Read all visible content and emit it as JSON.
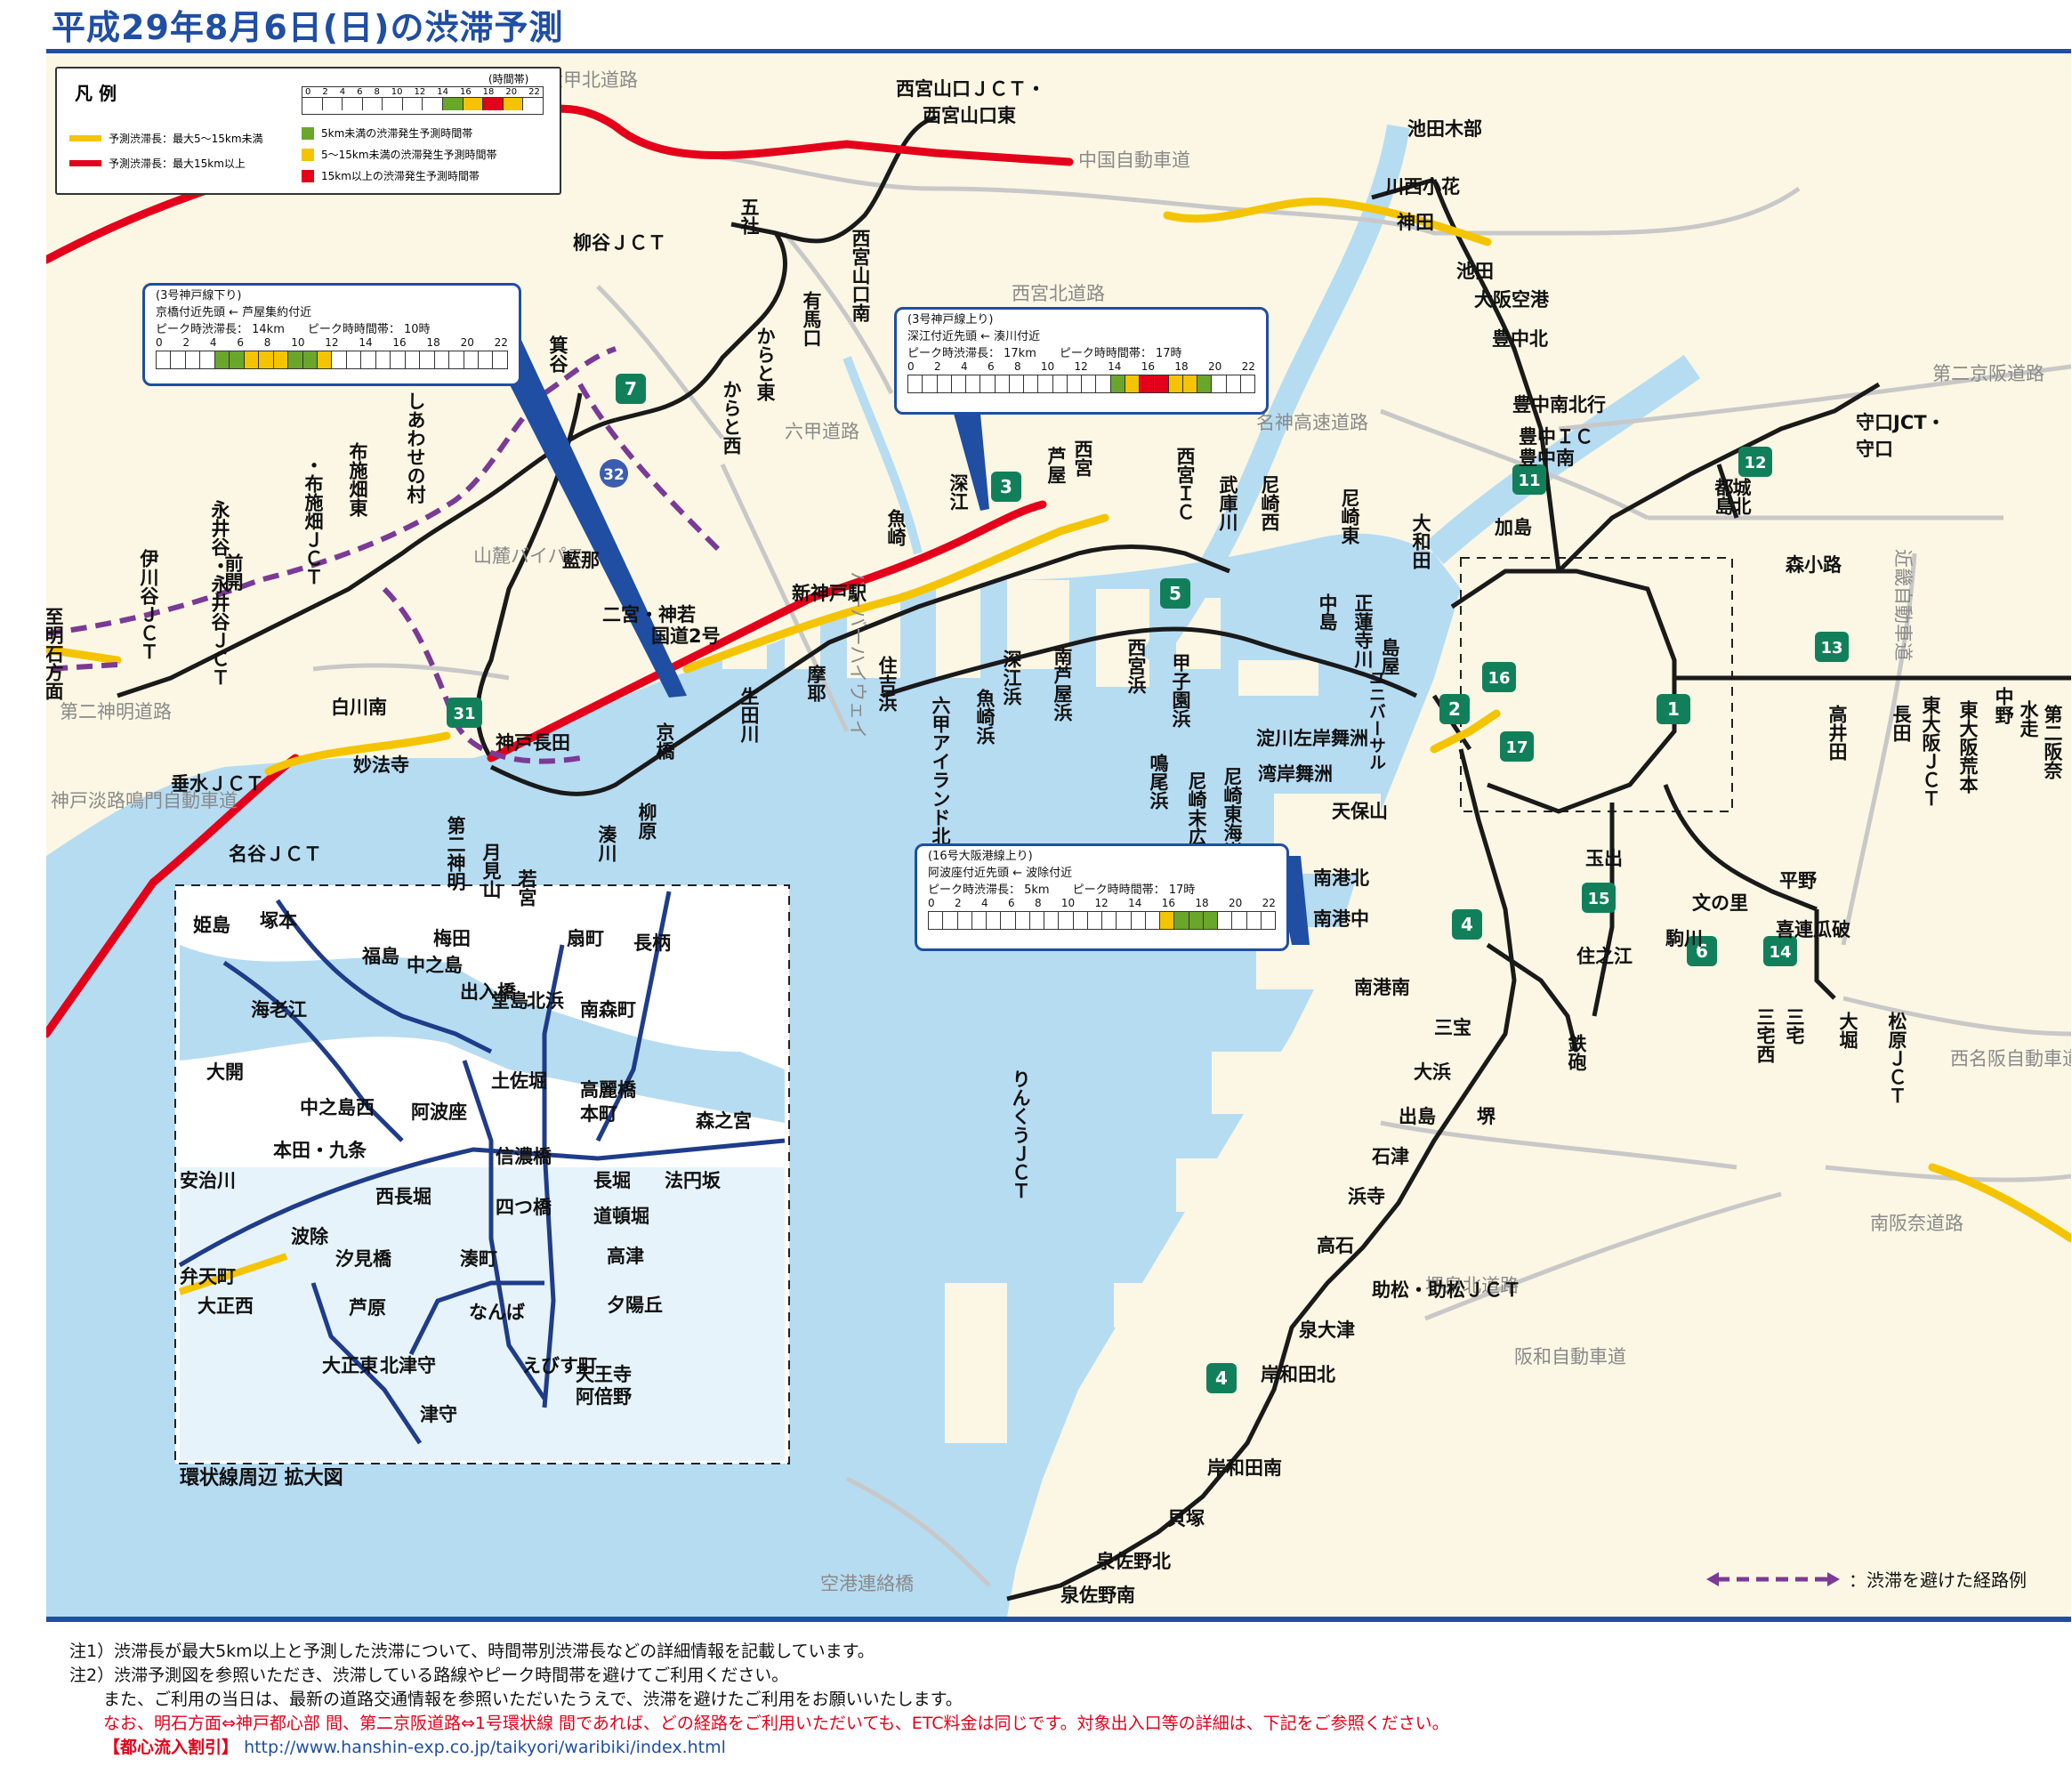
{
  "title": "平成29年8月6日(日)の渋滞予測",
  "colors": {
    "brand": "#1f4ea3",
    "sea": "#b6dcf2",
    "land": "#fbf7e4",
    "jam_red": "#e4001a",
    "jam_yellow": "#f5c400",
    "green_cell": "#6aa62c",
    "detour": "#7b3a96"
  },
  "legend": {
    "heading": "凡 例",
    "time_band_label": "(時間帯)",
    "ticks": [
      "0",
      "2",
      "4",
      "6",
      "8",
      "10",
      "12",
      "14",
      "16",
      "18",
      "20",
      "22"
    ],
    "arrow_yellow": "予測渋滞長：最大5～15km未満",
    "arrow_red": "予測渋滞長：最大15km以上",
    "cell_green": "5km未満の渋滞発生予測時間帯",
    "cell_yellow": "5～15km未満の渋滞発生予測時間帯",
    "cell_red": "15km以上の渋滞発生予測時間帯"
  },
  "callouts": [
    {
      "line1": "(3号神戸線下り)",
      "line2": "京橋付近先頭 ← 芦屋集約付近",
      "line3": "ピーク時渋滞長： 14km　　ピーク時時間帯： 10時",
      "levels": [
        0,
        0,
        0,
        0,
        1,
        1,
        2,
        2,
        2,
        1,
        1,
        2,
        0,
        0,
        0,
        0,
        0,
        0,
        0,
        0,
        0,
        0,
        0,
        0
      ]
    },
    {
      "line1": "(3号神戸線上り)",
      "line2": "深江付近先頭 ← 湊川付近",
      "line3": "ピーク時渋滞長： 17km　　ピーク時時間帯： 17時",
      "levels": [
        0,
        0,
        0,
        0,
        0,
        0,
        0,
        0,
        0,
        0,
        0,
        0,
        0,
        0,
        1,
        2,
        3,
        3,
        2,
        2,
        1,
        0,
        0,
        0
      ]
    },
    {
      "line1": "(16号大阪港線上り)",
      "line2": "阿波座付近先頭 ← 波除付近",
      "line3": "ピーク時渋滞長： 5km　　ピーク時時間帯： 17時",
      "levels": [
        0,
        0,
        0,
        0,
        0,
        0,
        0,
        0,
        0,
        0,
        0,
        0,
        0,
        0,
        0,
        0,
        2,
        1,
        1,
        1,
        0,
        0,
        0,
        0
      ]
    }
  ],
  "road_names": [
    "六甲北道路",
    "中国自動車道",
    "西宮北道路",
    "第二京阪道路",
    "名神高速道路",
    "六甲道路",
    "山麓バイパス",
    "第二神明道路",
    "神戸淡路鳴門自動車道",
    "ハーバーハイウェイ",
    "近畿自動車道",
    "西名阪自動車道",
    "南阪奈道路",
    "堺泉北道路",
    "阪和自動車道",
    "空港連絡橋"
  ],
  "route_numbers": [
    "7",
    "32",
    "3",
    "5",
    "31",
    "11",
    "12",
    "13",
    "16",
    "1",
    "2",
    "17",
    "15",
    "4",
    "6",
    "14",
    "4"
  ],
  "places": {
    "nishinomiya_yamaguchi": "西宮山口ＪＣＴ・",
    "nishinomiya_yamaguchi_e": "西宮山口東",
    "yanagitani": "柳谷ＪＣＴ",
    "goya": "五社",
    "nishinomiya_yamaguchi_s": "西宮山口南",
    "arima": "有馬口",
    "karato_e": "からと東",
    "karato_w": "からと西",
    "minoya": "箕谷",
    "ikedakibe": "池田木部",
    "kawanishi": "川西小花",
    "kanda": "神田",
    "ikeda": "池田",
    "osaka_airport": "大阪空港",
    "toyonaka_n": "豊中北",
    "toyonaka_mb": "豊中南北行",
    "toyonaka_ic": "豊中ＩＣ",
    "toyonaka_s": "豊中南",
    "kashima": "加島",
    "moriguchi": "守口JCT・",
    "moriguchi2": "守口",
    "miyakojima": "都島",
    "shirokita": "城北",
    "morishoji": "森小路",
    "shiawase": "しあわせの村",
    "aina": "藍那",
    "shinkobe": "新神戸駅",
    "ninomiya": "二宮・神若",
    "kokudo2": "国道2号",
    "fukae": "深江",
    "ashiya": "芦屋",
    "nishinomiya": "西宮",
    "uozaki": "魚崎",
    "nishinomiya_ic": "西宮ＩＣ",
    "mukogawa": "武庫川",
    "amagasaki_w": "尼崎西",
    "amagasaki_e": "尼崎東",
    "yamato": "大和田",
    "nakajima": "中島",
    "tsukamoto": "正蓮寺川",
    "shimaya": "島屋",
    "yumeshima": "ユニバーサル",
    "iwaya": "伊川谷ＪＣＴ",
    "eigaya": "永井谷・永井谷ＪＣＴ",
    "maeake": "前開",
    "fuseihata_jct": "・布施畑ＪＣＴ",
    "fuseihata_w": "布施畑西",
    "fuseihata_e": "布施畑東",
    "shirakawa": "白川南",
    "myohoji": "妙法寺",
    "kobe_nagata": "神戸長田",
    "tarumi": "垂水ＪＣＴ",
    "nadani": "名谷ＪＣＴ",
    "tsukimiyama": "月見山",
    "daini_shinmei": "第二神明",
    "wakamiya": "若宮",
    "minatogawa": "湊川",
    "yanagihara": "柳原",
    "kyobashi": "京橋",
    "ikutagawa": "生田川",
    "maya": "摩耶",
    "sumiyoshi": "住吉浜",
    "rokko": "六甲アイランド北",
    "uozakihama": "魚崎浜",
    "fukaehama": "深江浜",
    "minamiashiya": "南芦屋浜",
    "nishinomiyahama": "西宮浜",
    "koshien": "甲子園浜",
    "naruo": "鳴尾浜",
    "amasuehiro": "尼崎末広",
    "amahigashi": "尼崎東海岸",
    "yodogawa": "淀川左岸舞洲",
    "wangan_maishima": "湾岸舞洲",
    "tempozan": "天保山",
    "nankokita": "南港北",
    "nankonaka": "南港中",
    "nankominami": "南港南",
    "sanpo": "三宝",
    "tetsuho": "鉄砲",
    "sakai": "堺",
    "ohama": "大浜",
    "dejima": "出島",
    "ishizu": "石津",
    "hamadera": "浜寺",
    "takaishi": "高石",
    "sukematsu": "助松・助松ＪＣＴ",
    "izumiotsu": "泉大津",
    "kishiwada_n": "岸和田北",
    "kishiwada_s": "岸和田南",
    "kaizuka": "貝塚",
    "izumisano_n": "泉佐野北",
    "izumisano_s": "泉佐野南",
    "rinku": "りんくうＪＣＴ",
    "tamade": "玉出",
    "suminoe": "住之江",
    "komagawa": "駒川",
    "fuminosato": "文の里",
    "hirano": "平野",
    "kirenuri": "喜連瓜破",
    "mitakunishi": "三宅西",
    "mitaku": "三宅",
    "ohori": "大堀",
    "matsubara": "松原ＪＣＴ",
    "takaida": "高井田",
    "nagata": "長田",
    "higashiosaka_jct": "東大阪ＪＣＴ",
    "higashiosaka_arama": "東大阪荒本",
    "nakano": "中野",
    "mizuhase": "水走",
    "daini_hanna": "第二阪奈",
    "akashi": "至明石方面"
  },
  "inset": {
    "title": "環状線周辺 拡大図",
    "places": [
      "姫島",
      "塚本",
      "海老江",
      "福島",
      "中之島",
      "梅田",
      "出入橋",
      "堂島",
      "北浜",
      "扇町",
      "長柄",
      "南森町",
      "大開",
      "土佐堀",
      "高麗橋",
      "本町",
      "中之島西",
      "阿波座",
      "森之宮",
      "本田・九条",
      "信濃橋",
      "長堀",
      "法円坂",
      "安治川",
      "西長堀",
      "四つ橋",
      "道頓堀",
      "波除",
      "湊町",
      "高津",
      "汐見橋",
      "弁天町",
      "大正西",
      "芦原",
      "なんば",
      "夕陽丘",
      "えびす町",
      "天王寺",
      "阿倍野",
      "大正東",
      "北津守",
      "津守"
    ]
  },
  "route_legend": "：渋滞を避けた経路例",
  "notes": {
    "n1": "注1）渋滞長が最大5km以上と予測した渋滞について、時間帯別渋滞長などの詳細情報を記載しています。",
    "n2": "注2）渋滞予測図を参照いただき、渋滞している路線やピーク時間帯を避けてご利用ください。",
    "n3": "また、ご利用の当日は、最新の道路交通情報を参照いただいたうえで、渋滞を避けたご利用をお願いいたします。",
    "n4": "なお、明石方面⇔神戸都心部 間、第二京阪道路⇔1号環状線 間であれば、どの経路をご利用いただいても、ETC料金は同じです。対象出入口等の詳細は、下記をご参照ください。",
    "n5_label": "【都心流入割引】",
    "n5_url": "http://www.hanshin-exp.co.jp/taikyori/waribiki/index.html"
  }
}
